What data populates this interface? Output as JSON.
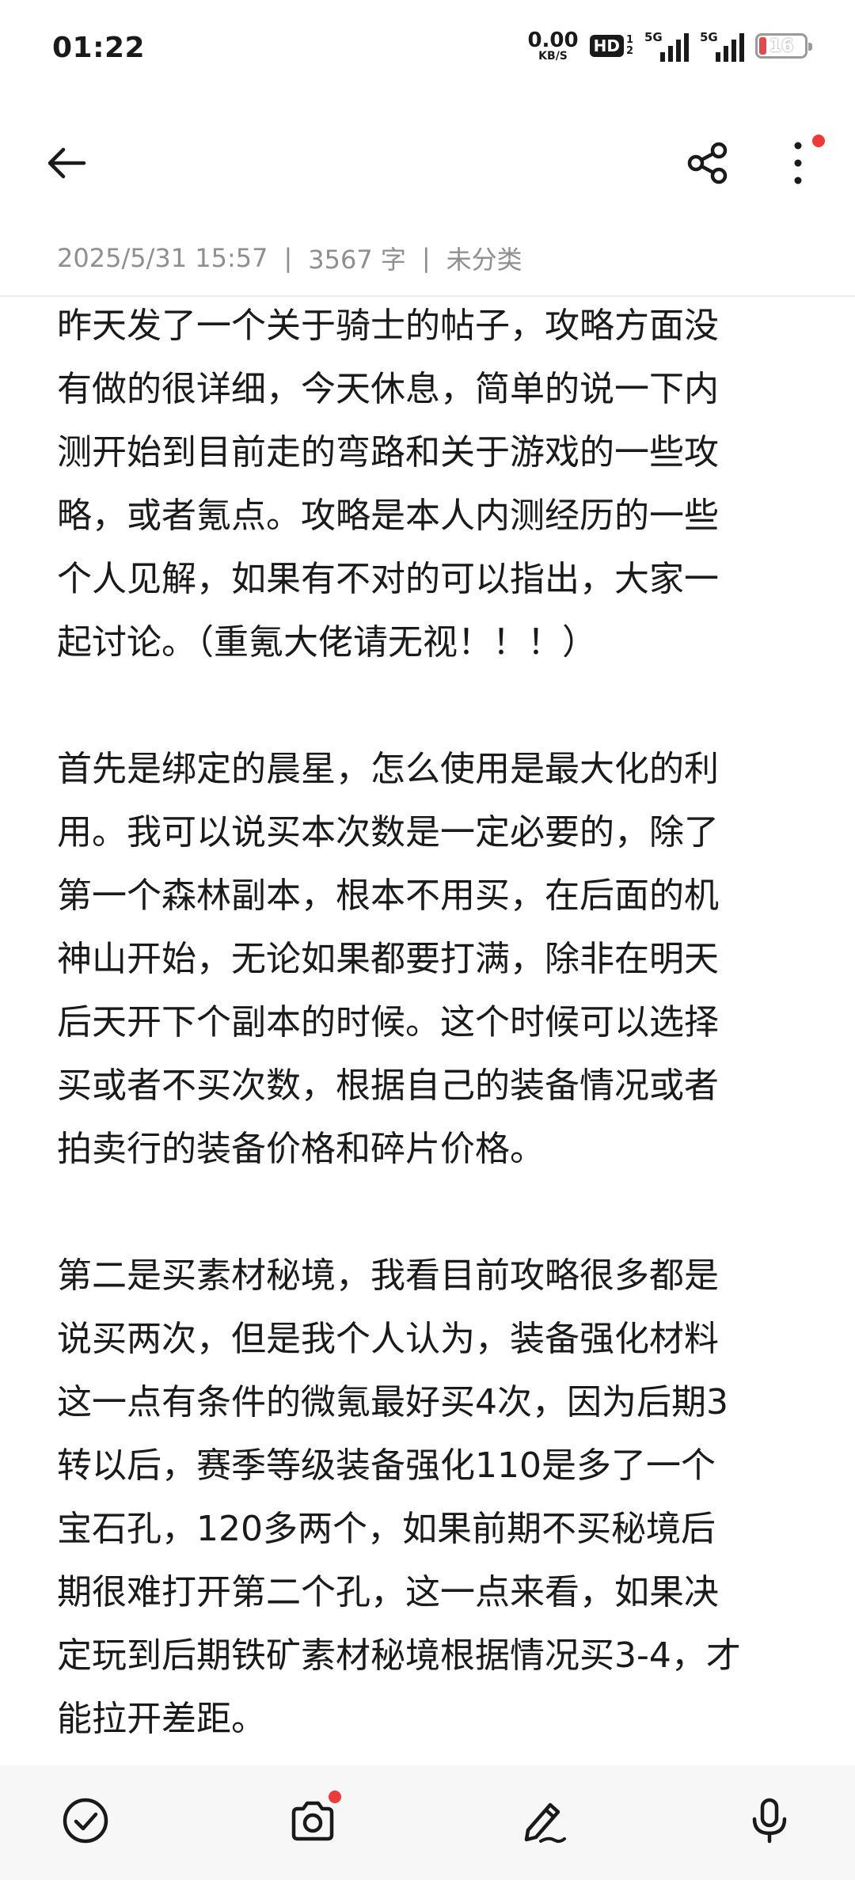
{
  "status_bar": {
    "time": "01:22",
    "net_speed_value": "0.00",
    "net_speed_unit": "KB/S",
    "hd_label": "HD",
    "hd_sub_1": "1",
    "hd_sub_2": "2",
    "sim1_label": "5G",
    "sim2_label": "5G",
    "battery_level": "16",
    "battery_fraction": 0.16,
    "battery_color": "#e24b4b"
  },
  "app_bar": {
    "back_icon": "arrow-left-icon",
    "share_icon": "share-icon",
    "more_icon": "more-vertical-icon",
    "notification_dot_color": "#f03a3a"
  },
  "meta": {
    "date": "2025/5/31 15:57",
    "separator": "|",
    "word_count": "3567 字",
    "category": "未分类"
  },
  "note": {
    "paragraphs": [
      "昨天发了一个关于骑士的帖子，攻略方面没\n有做的很详细，今天休息，简单的说一下内\n测开始到目前走的弯路和关于游戏的一些攻\n略，或者氪点。攻略是本人内测经历的一些\n个人见解，如果有不对的可以指出，大家一\n起讨论。（重氪大佬请无视！！！）",
      "首先是绑定的晨星，怎么使用是最大化的利\n用。我可以说买本次数是一定必要的，除了\n第一个森林副本，根本不用买，在后面的机\n神山开始，无论如果都要打满，除非在明天\n后天开下个副本的时候。这个时候可以选择\n买或者不买次数，根据自己的装备情况或者\n拍卖行的装备价格和碎片价格。",
      "第二是买素材秘境，我看目前攻略很多都是\n说买两次，但是我个人认为，装备强化材料\n这一点有条件的微氪最好买4次，因为后期3\n转以后，赛季等级装备强化110是多了一个\n宝石孔，120多两个，如果前期不买秘境后\n期很难打开第二个孔，这一点来看，如果决\n定玩到后期铁矿素材秘境根据情况买3-4，才\n能拉开差距。"
    ]
  },
  "toolbar": {
    "items": [
      "checklist-icon",
      "camera-icon",
      "pen-icon",
      "microphone-icon"
    ]
  }
}
